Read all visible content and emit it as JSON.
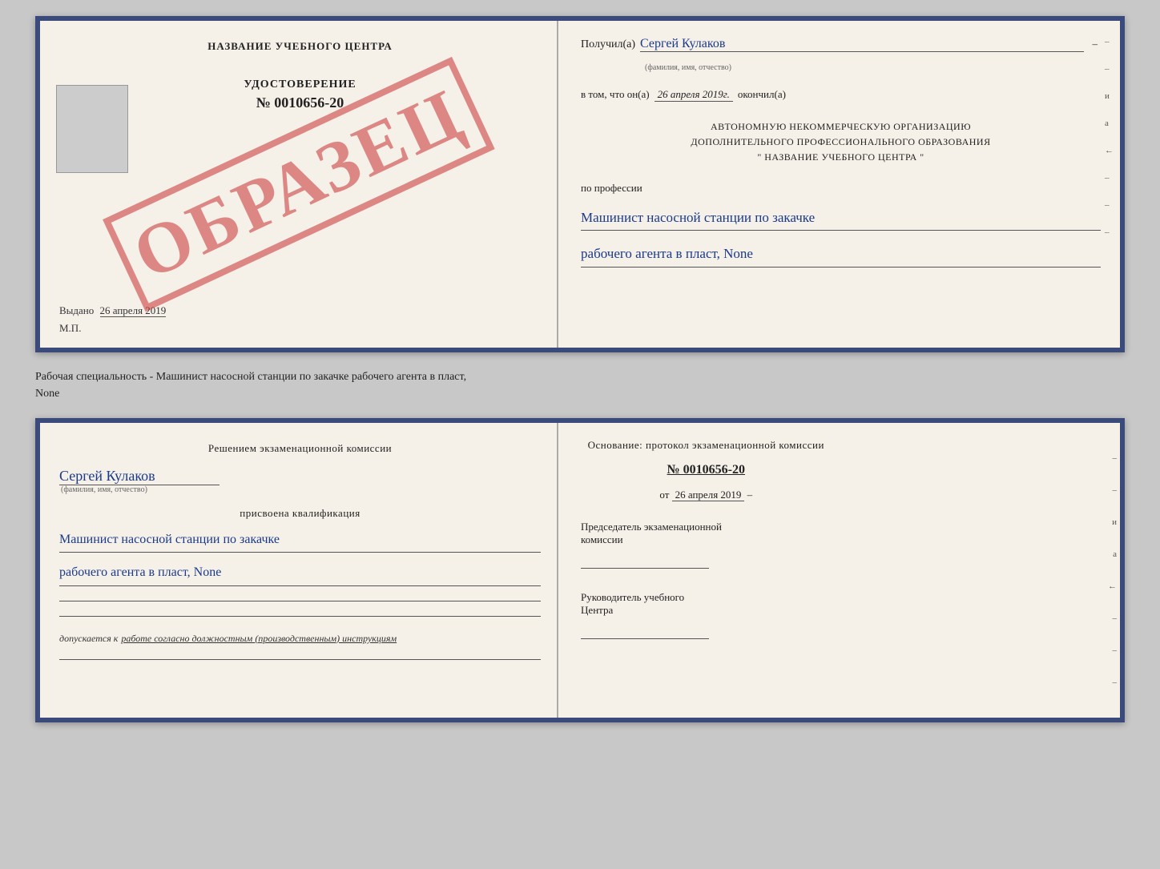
{
  "top_doc": {
    "left": {
      "center_title": "НАЗВАНИЕ УЧЕБНОГО ЦЕНТРА",
      "watermark": "ОБРАЗЕЦ",
      "cert_title": "УДОСТОВЕРЕНИЕ",
      "cert_number": "№ 0010656-20",
      "issued_label": "Выдано",
      "issued_date": "26 апреля 2019",
      "mp_label": "М.П."
    },
    "right": {
      "recipient_prefix": "Получил(а)",
      "recipient_name": "Сергей Кулаков",
      "recipient_hint": "(фамилия, имя, отчество)",
      "date_prefix": "в том, что он(а)",
      "date_value": "26 апреля 2019г.",
      "date_suffix": "окончил(а)",
      "org_line1": "АВТОНОМНУЮ НЕКОММЕРЧЕСКУЮ ОРГАНИЗАЦИЮ",
      "org_line2": "ДОПОЛНИТЕЛЬНОГО ПРОФЕССИОНАЛЬНОГО ОБРАЗОВАНИЯ",
      "org_line3": "\" НАЗВАНИЕ УЧЕБНОГО ЦЕНТРА \"",
      "profession_label": "по профессии",
      "profession_line1": "Машинист насосной станции по закачке",
      "profession_line2": "рабочего агента в пласт, None"
    }
  },
  "bottom_label": {
    "text": "Рабочая специальность - Машинист насосной станции по закачке рабочего агента в пласт,",
    "text2": "None"
  },
  "bottom_doc": {
    "left": {
      "decision_text": "Решением экзаменационной комиссии",
      "person_name": "Сергей Кулаков",
      "person_hint": "(фамилия, имя, отчество)",
      "assigned_label": "присвоена квалификация",
      "qualification_line1": "Машинист насосной станции по закачке",
      "qualification_line2": "рабочего агента в пласт, None",
      "allowed_prefix": "допускается к",
      "allowed_text": "работе согласно должностным (производственным) инструкциям"
    },
    "right": {
      "basis_label": "Основание: протокол экзаменационной комиссии",
      "protocol_number": "№ 0010656-20",
      "protocol_date_prefix": "от",
      "protocol_date": "26 апреля 2019",
      "chairman_label": "Председатель экзаменационной",
      "chairman_label2": "комиссии",
      "head_label": "Руководитель учебного",
      "head_label2": "Центра"
    }
  },
  "vertical_marks": [
    "–",
    "–",
    "и",
    "а",
    "←",
    "–",
    "–",
    "–"
  ]
}
